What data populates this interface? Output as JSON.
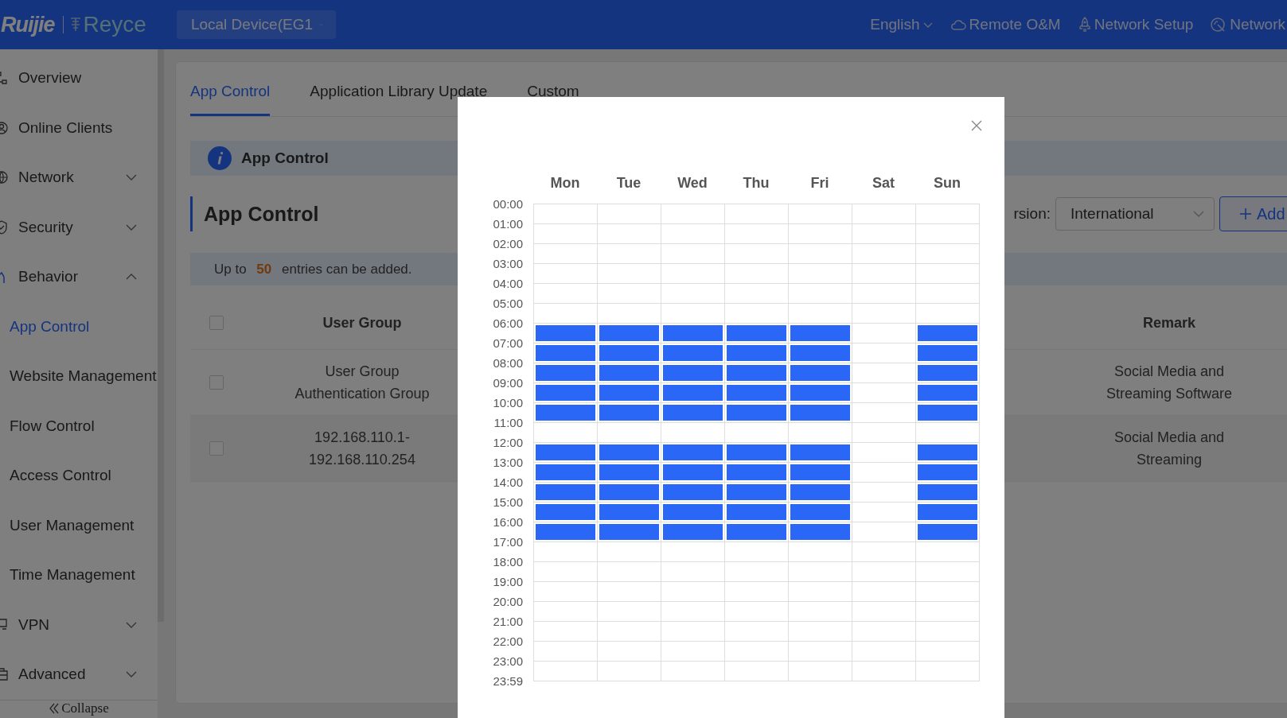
{
  "header": {
    "logo": "Ruijie",
    "brand": "Reyce",
    "device": "Local Device(EG1",
    "links": [
      {
        "label": "English",
        "kind": "language"
      },
      {
        "label": "Remote O&M",
        "kind": "cloud"
      },
      {
        "label": "Network Setup",
        "kind": "rocket"
      },
      {
        "label": "Network",
        "kind": "radar"
      }
    ]
  },
  "sidebar": {
    "items": [
      {
        "label": "Overview"
      },
      {
        "label": "Online Clients"
      },
      {
        "label": "Network",
        "expanded": false
      },
      {
        "label": "Security",
        "expanded": false
      },
      {
        "label": "Behavior",
        "expanded": true,
        "children": [
          {
            "label": "App Control",
            "selected": true
          },
          {
            "label": "Website Management",
            "selected": false
          },
          {
            "label": "Flow Control",
            "selected": false
          },
          {
            "label": "Access Control",
            "selected": false
          },
          {
            "label": "User Management",
            "selected": false
          },
          {
            "label": "Time Management",
            "selected": false
          }
        ]
      },
      {
        "label": "VPN",
        "expanded": false
      },
      {
        "label": "Advanced",
        "expanded": false
      }
    ],
    "collapse": "Collapse"
  },
  "tabs": [
    {
      "label": "App Control",
      "selected": true
    },
    {
      "label": "Application Library Update",
      "selected": false
    },
    {
      "label": "Custom",
      "selected": false
    }
  ],
  "info_banner": "App Control",
  "section_title": "App Control",
  "toolbar": {
    "version_label": "rsion:",
    "version": "International",
    "add": "Add"
  },
  "notice": "Up to **50** entries can be added.",
  "table": {
    "header_checked": false,
    "columns": [
      "User Group",
      "Remark"
    ],
    "rows": [
      {
        "checked": false,
        "user_group": [
          "User Group",
          "Authentication Group"
        ],
        "remark": "Social Media and Streaming Software"
      },
      {
        "checked": false,
        "user_group": [
          "192.168.110.1-",
          "192.168.110.254"
        ],
        "remark": "Social Media and Streaming"
      }
    ]
  },
  "modal": {
    "times": [
      "00:00",
      "01:00",
      "02:00",
      "03:00",
      "04:00",
      "05:00",
      "06:00",
      "07:00",
      "08:00",
      "09:00",
      "10:00",
      "11:00",
      "12:00",
      "13:00",
      "14:00",
      "15:00",
      "16:00",
      "17:00",
      "18:00",
      "19:00",
      "20:00",
      "21:00",
      "22:00",
      "23:00",
      "23:59"
    ],
    "days": [
      {
        "label": "Mon",
        "hours": [
          false,
          false,
          false,
          false,
          false,
          false,
          true,
          true,
          true,
          true,
          true,
          false,
          true,
          true,
          true,
          true,
          true,
          false,
          false,
          false,
          false,
          false,
          false,
          false
        ]
      },
      {
        "label": "Tue",
        "hours": [
          false,
          false,
          false,
          false,
          false,
          false,
          true,
          true,
          true,
          true,
          true,
          false,
          true,
          true,
          true,
          true,
          true,
          false,
          false,
          false,
          false,
          false,
          false,
          false
        ]
      },
      {
        "label": "Wed",
        "hours": [
          false,
          false,
          false,
          false,
          false,
          false,
          true,
          true,
          true,
          true,
          true,
          false,
          true,
          true,
          true,
          true,
          true,
          false,
          false,
          false,
          false,
          false,
          false,
          false
        ]
      },
      {
        "label": "Thu",
        "hours": [
          false,
          false,
          false,
          false,
          false,
          false,
          true,
          true,
          true,
          true,
          true,
          false,
          true,
          true,
          true,
          true,
          true,
          false,
          false,
          false,
          false,
          false,
          false,
          false
        ]
      },
      {
        "label": "Fri",
        "hours": [
          false,
          false,
          false,
          false,
          false,
          false,
          true,
          true,
          true,
          true,
          true,
          false,
          true,
          true,
          true,
          true,
          true,
          false,
          false,
          false,
          false,
          false,
          false,
          false
        ]
      },
      {
        "label": "Sat",
        "hours": [
          false,
          false,
          false,
          false,
          false,
          false,
          false,
          false,
          false,
          false,
          false,
          false,
          false,
          false,
          false,
          false,
          false,
          false,
          false,
          false,
          false,
          false,
          false,
          false
        ]
      },
      {
        "label": "Sun",
        "hours": [
          false,
          false,
          false,
          false,
          false,
          false,
          true,
          true,
          true,
          true,
          true,
          false,
          true,
          true,
          true,
          true,
          true,
          false,
          false,
          false,
          false,
          false,
          false,
          false
        ]
      }
    ]
  }
}
